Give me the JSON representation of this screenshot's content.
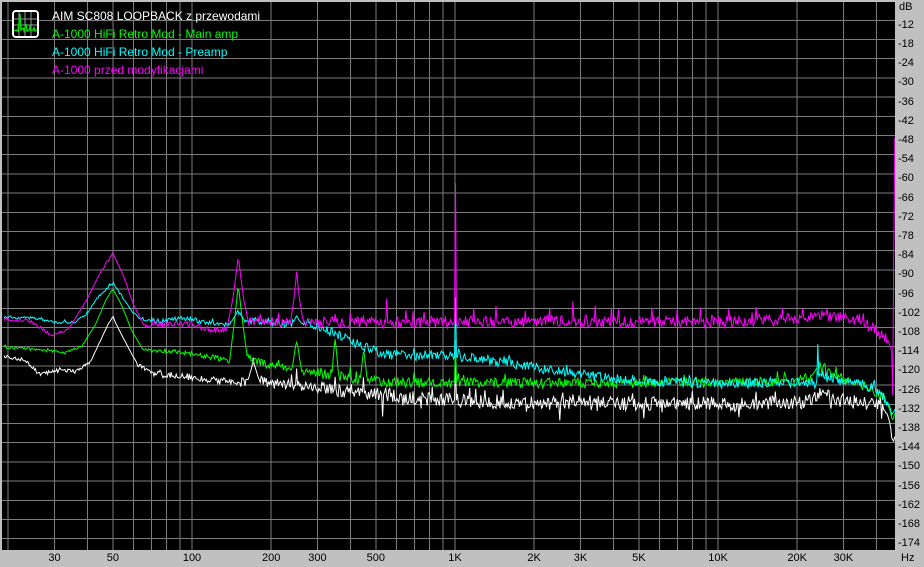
{
  "window": {
    "bg": "#c0c0c0",
    "plot_bg": "#000000",
    "grid_color": "#7d7d7d",
    "label_color": "#000000"
  },
  "legend": {
    "items": [
      {
        "label": "AIM SC808 LOOPBACK z przewodami",
        "color": "#ffffff"
      },
      {
        "label": "A-1000 HiFi Retro Mod - Main amp",
        "color": "#00ff00"
      },
      {
        "label": "A-1000 HiFi Retro Mod - Preamp",
        "color": "#00ffff"
      },
      {
        "label": "A-1000 przed modyfikacjami",
        "color": "#ff00ff"
      }
    ]
  },
  "axes": {
    "y": {
      "unit_label": "dB"
    },
    "x": {
      "unit_label": "Hz"
    }
  },
  "chart_data": {
    "type": "line",
    "title": "",
    "x_scale": "log",
    "x_unit": "Hz",
    "y_unit": "dB",
    "x_range": [
      19.3,
      47000
    ],
    "y_gridlines": {
      "min": -174,
      "max": -6,
      "step": 6
    },
    "grid": true,
    "legend_position": "top-left",
    "y_tick_labels": [
      "-12",
      "-18",
      "-24",
      "-30",
      "-36",
      "-42",
      "-48",
      "-54",
      "-60",
      "-66",
      "-72",
      "-78",
      "-84",
      "-90",
      "-96",
      "-102",
      "-108",
      "-114",
      "-120",
      "-126",
      "-132",
      "-138",
      "-144",
      "-150",
      "-156",
      "-162",
      "-168",
      "-174"
    ],
    "x_tick_labels": [
      {
        "text": "30",
        "f": 30
      },
      {
        "text": "50",
        "f": 50
      },
      {
        "text": "100",
        "f": 100
      },
      {
        "text": "200",
        "f": 200
      },
      {
        "text": "300",
        "f": 300
      },
      {
        "text": "500",
        "f": 500
      },
      {
        "text": "1K",
        "f": 1000
      },
      {
        "text": "2K",
        "f": 2000
      },
      {
        "text": "3K",
        "f": 3000
      },
      {
        "text": "5K",
        "f": 5000
      },
      {
        "text": "10K",
        "f": 10000
      },
      {
        "text": "20K",
        "f": 20000
      },
      {
        "text": "30K",
        "f": 30000
      }
    ],
    "series": [
      {
        "name": "AIM SC808 LOOPBACK z przewodami",
        "color": "#ffffff",
        "jitter": 2.2,
        "burst": 2.4,
        "down_burst": true,
        "floor": [
          [
            19.3,
            -117
          ],
          [
            23,
            -118.2
          ],
          [
            26.5,
            -122.8
          ],
          [
            31,
            -121
          ],
          [
            36,
            -121.8
          ],
          [
            41,
            -119
          ],
          [
            45,
            -111.8
          ],
          [
            48,
            -107
          ],
          [
            50,
            -104.7
          ],
          [
            53,
            -109
          ],
          [
            57,
            -114
          ],
          [
            62,
            -119.5
          ],
          [
            70,
            -122
          ],
          [
            82,
            -122.9
          ],
          [
            95,
            -123.4
          ],
          [
            110,
            -124
          ],
          [
            130,
            -124.8
          ],
          [
            150,
            -125
          ],
          [
            163,
            -124.6
          ],
          [
            171,
            -118.8
          ],
          [
            180,
            -124.4
          ],
          [
            200,
            -125.5
          ],
          [
            230,
            -125.9
          ],
          [
            260,
            -126.2
          ],
          [
            300,
            -126.9
          ],
          [
            350,
            -127.4
          ],
          [
            420,
            -128.1
          ],
          [
            500,
            -128.7
          ],
          [
            620,
            -129.5
          ],
          [
            780,
            -130.2
          ],
          [
            1000,
            -130.7
          ],
          [
            1400,
            -131.1
          ],
          [
            2000,
            -131.4
          ],
          [
            3000,
            -131.6
          ],
          [
            4500,
            -131.7
          ],
          [
            6500,
            -131.8
          ],
          [
            9000,
            -131.8
          ],
          [
            12000,
            -131.8
          ],
          [
            15000,
            -131.6
          ],
          [
            18000,
            -131.5
          ],
          [
            21000,
            -131.3
          ],
          [
            23500,
            -129
          ],
          [
            24800,
            -127.7
          ],
          [
            26500,
            -129.6
          ],
          [
            29000,
            -130.7
          ],
          [
            32000,
            -131.2
          ],
          [
            36000,
            -131.6
          ],
          [
            40000,
            -132
          ],
          [
            42500,
            -133.2
          ],
          [
            44200,
            -135.5
          ],
          [
            45300,
            -139
          ],
          [
            45900,
            -143.3
          ]
        ],
        "spikes": [
          [
            250,
            -120.8
          ],
          [
            350,
            -123.4
          ],
          [
            450,
            -123.6
          ],
          [
            530,
            -135.8
          ],
          [
            1000,
            -120.2
          ],
          [
            1300,
            -127.6
          ],
          [
            2500,
            -137
          ],
          [
            5200,
            -136.4
          ],
          [
            8000,
            -127.9
          ],
          [
            12000,
            -136
          ],
          [
            16500,
            -128
          ]
        ]
      },
      {
        "name": "A-1000 HiFi Retro Mod - Main amp",
        "color": "#00ff00",
        "jitter": 1.6,
        "burst": 2.2,
        "down_burst": false,
        "floor": [
          [
            19.3,
            -114.2
          ],
          [
            26,
            -114.9
          ],
          [
            33,
            -115.9
          ],
          [
            38,
            -114
          ],
          [
            43,
            -107
          ],
          [
            47,
            -99.5
          ],
          [
            50,
            -95.9
          ],
          [
            54,
            -101
          ],
          [
            59,
            -109
          ],
          [
            65,
            -114.8
          ],
          [
            78,
            -115.3
          ],
          [
            95,
            -115.9
          ],
          [
            110,
            -116.8
          ],
          [
            125,
            -117.6
          ],
          [
            139,
            -118.6
          ],
          [
            145,
            -106
          ],
          [
            150,
            -94.7
          ],
          [
            156,
            -107
          ],
          [
            162,
            -117
          ],
          [
            180,
            -119
          ],
          [
            205,
            -120.2
          ],
          [
            228,
            -120.9
          ],
          [
            240,
            -121.2
          ],
          [
            250,
            -111.5
          ],
          [
            261,
            -121.7
          ],
          [
            285,
            -122
          ],
          [
            315,
            -122.5
          ],
          [
            340,
            -122.9
          ],
          [
            350,
            -110.8
          ],
          [
            361,
            -123.1
          ],
          [
            385,
            -123.5
          ],
          [
            405,
            -123.7
          ],
          [
            436,
            -124.1
          ],
          [
            450,
            -114.6
          ],
          [
            464,
            -124.6
          ],
          [
            520,
            -125
          ],
          [
            620,
            -125.2
          ],
          [
            800,
            -125.3
          ],
          [
            1100,
            -125.2
          ],
          [
            1600,
            -125.3
          ],
          [
            2400,
            -125.4
          ],
          [
            3600,
            -125.4
          ],
          [
            5000,
            -125.3
          ],
          [
            7000,
            -125.3
          ],
          [
            9500,
            -125.2
          ],
          [
            12500,
            -125.1
          ],
          [
            16000,
            -125
          ],
          [
            19500,
            -124.7
          ],
          [
            22500,
            -123.4
          ],
          [
            24000,
            -122
          ],
          [
            25200,
            -120.4
          ],
          [
            26500,
            -122.3
          ],
          [
            28500,
            -123.4
          ],
          [
            31000,
            -124.3
          ],
          [
            34000,
            -125.8
          ],
          [
            37500,
            -127
          ],
          [
            40500,
            -128.6
          ],
          [
            43000,
            -130.5
          ],
          [
            44800,
            -133
          ],
          [
            45800,
            -136.3
          ]
        ],
        "spikes": [
          [
            400,
            -120.3
          ],
          [
            700,
            -122
          ],
          [
            1000,
            -112
          ],
          [
            1550,
            -122.5
          ],
          [
            5200,
            -122.8
          ]
        ]
      },
      {
        "name": "A-1000 HiFi Retro Mod - Preamp",
        "color": "#00ffff",
        "jitter": 1.6,
        "burst": 2.0,
        "down_burst": false,
        "floor": [
          [
            19.3,
            -104.9
          ],
          [
            25,
            -105.1
          ],
          [
            31,
            -106.6
          ],
          [
            36,
            -106.2
          ],
          [
            40,
            -103.5
          ],
          [
            45,
            -97.5
          ],
          [
            50,
            -94.3
          ],
          [
            55,
            -99
          ],
          [
            60,
            -103.8
          ],
          [
            66,
            -105.8
          ],
          [
            80,
            -105.9
          ],
          [
            92,
            -104.9
          ],
          [
            105,
            -105.9
          ],
          [
            120,
            -106.9
          ],
          [
            133,
            -107
          ],
          [
            140,
            -106.8
          ],
          [
            150,
            -102.6
          ],
          [
            160,
            -106.5
          ],
          [
            178,
            -105.9
          ],
          [
            200,
            -106.3
          ],
          [
            225,
            -106.9
          ],
          [
            241,
            -106.6
          ],
          [
            250,
            -104.3
          ],
          [
            260,
            -106.8
          ],
          [
            285,
            -107.2
          ],
          [
            320,
            -108.4
          ],
          [
            360,
            -110.5
          ],
          [
            410,
            -112.6
          ],
          [
            460,
            -114.4
          ],
          [
            520,
            -115.9
          ],
          [
            600,
            -116.6
          ],
          [
            700,
            -116.8
          ],
          [
            820,
            -116.4
          ],
          [
            950,
            -116.9
          ],
          [
            1100,
            -117.3
          ],
          [
            1350,
            -118.2
          ],
          [
            1700,
            -119.6
          ],
          [
            2100,
            -120.8
          ],
          [
            2700,
            -122.2
          ],
          [
            3400,
            -123.3
          ],
          [
            4200,
            -124.1
          ],
          [
            5200,
            -124.6
          ],
          [
            6500,
            -125
          ],
          [
            8000,
            -125.2
          ],
          [
            10000,
            -125.4
          ],
          [
            12500,
            -125.3
          ],
          [
            15000,
            -125.1
          ],
          [
            18000,
            -125
          ],
          [
            21000,
            -125.1
          ],
          [
            23500,
            -125.3
          ],
          [
            24800,
            -121.8
          ],
          [
            26000,
            -123.6
          ],
          [
            28000,
            -124.2
          ],
          [
            31000,
            -124.8
          ],
          [
            35000,
            -125.8
          ],
          [
            39000,
            -127.2
          ],
          [
            42000,
            -129
          ],
          [
            44000,
            -131
          ],
          [
            45500,
            -133.8
          ]
        ],
        "spikes": [
          [
            1005,
            -98.6
          ],
          [
            24000,
            -113.2
          ]
        ]
      },
      {
        "name": "A-1000 przed modyfikacjami",
        "color": "#ff00ff",
        "jitter": 1.9,
        "burst": 3.0,
        "down_burst": false,
        "floor": [
          [
            19.3,
            -105.5
          ],
          [
            24,
            -105.8
          ],
          [
            29.5,
            -110.6
          ],
          [
            34,
            -108.5
          ],
          [
            40,
            -99
          ],
          [
            45,
            -90.5
          ],
          [
            50,
            -84.8
          ],
          [
            55,
            -92
          ],
          [
            60,
            -101
          ],
          [
            66,
            -107.6
          ],
          [
            75,
            -107
          ],
          [
            85,
            -106.8
          ],
          [
            100,
            -106.9
          ],
          [
            115,
            -108.6
          ],
          [
            128,
            -108.9
          ],
          [
            136,
            -108
          ],
          [
            143,
            -99
          ],
          [
            150,
            -85.8
          ],
          [
            157,
            -99
          ],
          [
            164,
            -106.5
          ],
          [
            180,
            -105.6
          ],
          [
            200,
            -106.2
          ],
          [
            220,
            -106.8
          ],
          [
            237,
            -106.4
          ],
          [
            244,
            -99
          ],
          [
            250,
            -90.9
          ],
          [
            257,
            -100
          ],
          [
            265,
            -106.3
          ],
          [
            290,
            -106.6
          ],
          [
            330,
            -106.3
          ],
          [
            400,
            -106.5
          ],
          [
            500,
            -106.4
          ],
          [
            700,
            -106.5
          ],
          [
            900,
            -106.4
          ],
          [
            1200,
            -106.3
          ],
          [
            1600,
            -106.4
          ],
          [
            2200,
            -106.3
          ],
          [
            3000,
            -106.2
          ],
          [
            4500,
            -106.3
          ],
          [
            6500,
            -106.3
          ],
          [
            9000,
            -106.2
          ],
          [
            12000,
            -106
          ],
          [
            15000,
            -105.7
          ],
          [
            18000,
            -105.4
          ],
          [
            22000,
            -104.8
          ],
          [
            26000,
            -104.3
          ],
          [
            30000,
            -104.6
          ],
          [
            34000,
            -105.8
          ],
          [
            38000,
            -108
          ],
          [
            41000,
            -109.8
          ],
          [
            43000,
            -111
          ],
          [
            44500,
            -112.5
          ],
          [
            45300,
            -114
          ],
          [
            45900,
            -116
          ],
          [
            46300,
            -135
          ],
          [
            46800,
            -48.9
          ]
        ],
        "spikes": [
          [
            350,
            -103.8
          ],
          [
            450,
            -104.2
          ],
          [
            550,
            -98.9
          ],
          [
            650,
            -102.6
          ],
          [
            760,
            -103.2
          ],
          [
            1000,
            -62.9
          ],
          [
            1180,
            -102
          ],
          [
            1430,
            -101.3
          ],
          [
            1850,
            -102.8
          ],
          [
            2300,
            -101.8
          ],
          [
            2800,
            -99.8
          ],
          [
            3400,
            -101.2
          ],
          [
            4200,
            -102.3
          ],
          [
            5600,
            -101.8
          ],
          [
            7000,
            -102.3
          ],
          [
            8600,
            -101.8
          ],
          [
            11000,
            -102.2
          ],
          [
            14000,
            -101.6
          ],
          [
            17500,
            -101.9
          ],
          [
            21000,
            -102
          ]
        ]
      }
    ]
  }
}
